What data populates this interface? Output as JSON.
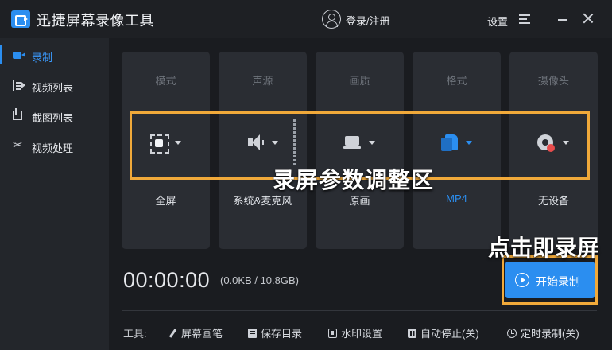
{
  "app": {
    "title": "迅捷屏幕录像工具"
  },
  "header": {
    "login": "登录/注册",
    "settings": "设置"
  },
  "sidebar": {
    "items": [
      {
        "label": "录制",
        "icon": "record-icon"
      },
      {
        "label": "视频列表",
        "icon": "video-list-icon"
      },
      {
        "label": "截图列表",
        "icon": "screenshot-list-icon"
      },
      {
        "label": "视频处理",
        "icon": "video-edit-icon"
      }
    ]
  },
  "params": [
    {
      "title": "模式",
      "value": "全屏",
      "icon": "fullscreen-icon"
    },
    {
      "title": "声源",
      "value": "系统&麦克风",
      "icon": "speaker-icon"
    },
    {
      "title": "画质",
      "value": "原画",
      "icon": "laptop-icon"
    },
    {
      "title": "格式",
      "value": "MP4",
      "icon": "file-format-icon"
    },
    {
      "title": "摄像头",
      "value": "无设备",
      "icon": "webcam-icon"
    }
  ],
  "annotations": {
    "params_area": "录屏参数调整区",
    "start_hint": "点击即录屏"
  },
  "recorder": {
    "timer": "00:00:00",
    "size": "(0.0KB / 10.8GB)",
    "start_label": "开始录制"
  },
  "toolbar": {
    "label": "工具:",
    "tools": [
      {
        "label": "屏幕画笔",
        "icon": "pen-icon"
      },
      {
        "label": "保存目录",
        "icon": "folder-icon"
      },
      {
        "label": "水印设置",
        "icon": "watermark-icon"
      },
      {
        "label": "自动停止(关)",
        "icon": "auto-stop-icon"
      },
      {
        "label": "定时录制(关)",
        "icon": "clock-icon"
      }
    ]
  },
  "colors": {
    "accent": "#2b8ef0",
    "annotation": "#f0a93a",
    "background": "#1a1c20"
  }
}
